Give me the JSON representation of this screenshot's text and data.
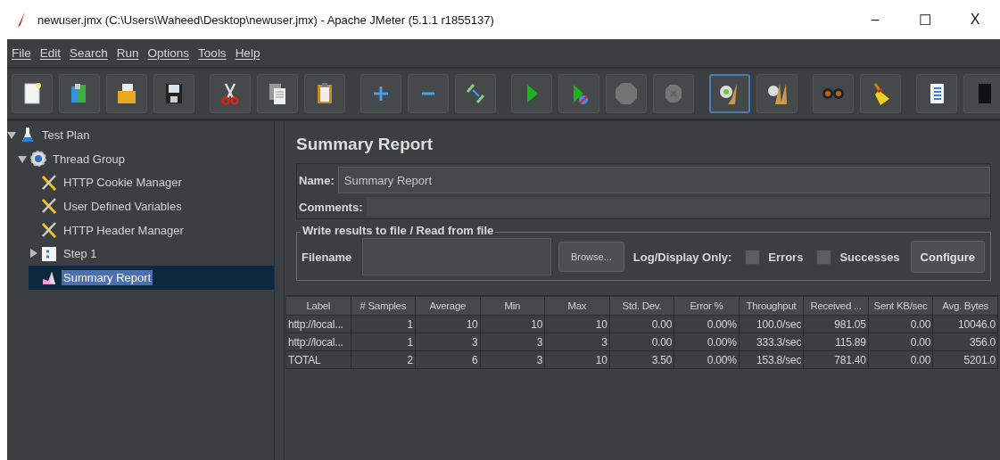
{
  "window": {
    "title": "newuser.jmx (C:\\Users\\Waheed\\Desktop\\newuser.jmx) - Apache JMeter (5.1.1 r1855137)",
    "controls": [
      "–",
      "☐",
      "X"
    ]
  },
  "menu": [
    {
      "label": "File"
    },
    {
      "label": "Edit"
    },
    {
      "label": "Search"
    },
    {
      "label": "Run"
    },
    {
      "label": "Options"
    },
    {
      "label": "Tools"
    },
    {
      "label": "Help"
    }
  ],
  "toolbar": [
    [
      {
        "kind": "new",
        "disabled": false,
        "focused": false
      },
      {
        "kind": "templates",
        "disabled": false,
        "focused": false
      },
      {
        "kind": "open",
        "disabled": false,
        "focused": false
      },
      {
        "kind": "save",
        "disabled": false,
        "focused": false
      }
    ],
    [
      {
        "kind": "cut",
        "disabled": false,
        "focused": false
      },
      {
        "kind": "copy",
        "disabled": false,
        "focused": false
      },
      {
        "kind": "paste",
        "disabled": false,
        "focused": false
      }
    ],
    [
      {
        "kind": "expand",
        "disabled": false,
        "focused": false
      },
      {
        "kind": "collapse",
        "disabled": false,
        "focused": false
      },
      {
        "kind": "toggle",
        "disabled": false,
        "focused": false
      }
    ],
    [
      {
        "kind": "start",
        "disabled": false,
        "focused": false
      },
      {
        "kind": "start-no-pause",
        "disabled": false,
        "focused": false
      },
      {
        "kind": "stop",
        "disabled": true,
        "focused": false
      },
      {
        "kind": "shutdown",
        "disabled": true,
        "focused": false
      }
    ],
    [
      {
        "kind": "clear",
        "disabled": false,
        "focused": true
      },
      {
        "kind": "clear-all",
        "disabled": false,
        "focused": false
      }
    ],
    [
      {
        "kind": "search",
        "disabled": false,
        "focused": false
      },
      {
        "kind": "reset-search",
        "disabled": false,
        "focused": false
      }
    ],
    [
      {
        "kind": "functions",
        "disabled": false,
        "focused": false
      },
      {
        "kind": "help",
        "disabled": false,
        "focused": false
      }
    ]
  ],
  "tree": [
    {
      "label": "Test Plan",
      "kind": "plan",
      "expanded": true,
      "selected": false,
      "children": [
        {
          "label": "Thread Group",
          "kind": "group",
          "expanded": true,
          "selected": false,
          "children": [
            {
              "label": "HTTP Cookie Manager",
              "kind": "config",
              "selected": false
            },
            {
              "label": "User Defined Variables",
              "kind": "config",
              "selected": false
            },
            {
              "label": "HTTP Header Manager",
              "kind": "config",
              "selected": false
            },
            {
              "label": "Step 1",
              "kind": "controller",
              "expanded": false,
              "selected": false
            },
            {
              "label": "Summary Report",
              "kind": "listener",
              "selected": true
            }
          ]
        }
      ]
    }
  ],
  "panel": {
    "title": "Summary Report",
    "name_label": "Name:",
    "name_value": "Summary Report",
    "comments_label": "Comments:",
    "file_group": {
      "legend": "Write results to file / Read from file",
      "filename_label": "Filename",
      "browse": "Browse...",
      "log_label": "Log/Display Only:",
      "options": [
        {
          "label": "Errors",
          "checked": false
        },
        {
          "label": "Successes",
          "checked": false
        }
      ],
      "configure": "Configure"
    },
    "table": {
      "columns": [
        "Label",
        "# Samples",
        "Average",
        "Min",
        "Max",
        "Std. Dev.",
        "Error %",
        "Throughput",
        "Received ...",
        "Sent KB/sec",
        "Avg. Bytes"
      ],
      "rows": [
        [
          "http://local...",
          "1",
          "10",
          "10",
          "10",
          "0.00",
          "0.00%",
          "100.0/sec",
          "981.05",
          "0.00",
          "10046.0"
        ],
        [
          "http://local...",
          "1",
          "3",
          "3",
          "3",
          "0.00",
          "0.00%",
          "333.3/sec",
          "115.89",
          "0.00",
          "356.0"
        ],
        [
          "TOTAL",
          "2",
          "6",
          "3",
          "10",
          "3.50",
          "0.00%",
          "153.8/sec",
          "781.40",
          "0.00",
          "5201.0"
        ]
      ]
    }
  }
}
